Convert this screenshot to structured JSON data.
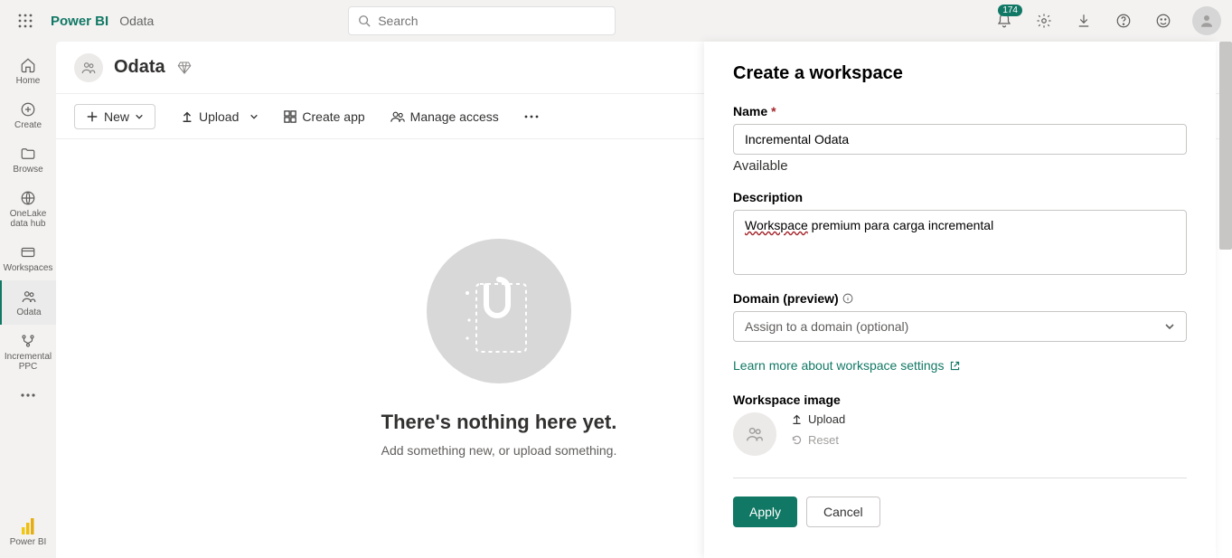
{
  "header": {
    "brand": "Power BI",
    "sub": "Odata",
    "search_placeholder": "Search",
    "notification_count": "174"
  },
  "leftrail": {
    "home": "Home",
    "create": "Create",
    "browse": "Browse",
    "onelake": "OneLake data hub",
    "workspaces": "Workspaces",
    "odata": "Odata",
    "inc_ppc": "Incremental PPC",
    "powerbi": "Power BI"
  },
  "main": {
    "workspace_title": "Odata",
    "new_label": "New",
    "upload_label": "Upload",
    "createapp_label": "Create app",
    "manage_label": "Manage access",
    "empty_title": "There's nothing here yet.",
    "empty_sub": "Add something new, or upload something."
  },
  "panel": {
    "title": "Create a workspace",
    "name_label": "Name",
    "name_value": "Incremental Odata",
    "name_status": "Available",
    "desc_label": "Description",
    "desc_value_word": "Workspace",
    "desc_value_rest": " premium para carga incremental",
    "domain_label": "Domain (preview)",
    "domain_placeholder": "Assign to a domain (optional)",
    "learn_link": "Learn more about workspace settings",
    "wsimg_label": "Workspace image",
    "wsimg_upload": "Upload",
    "wsimg_reset": "Reset",
    "apply": "Apply",
    "cancel": "Cancel"
  }
}
